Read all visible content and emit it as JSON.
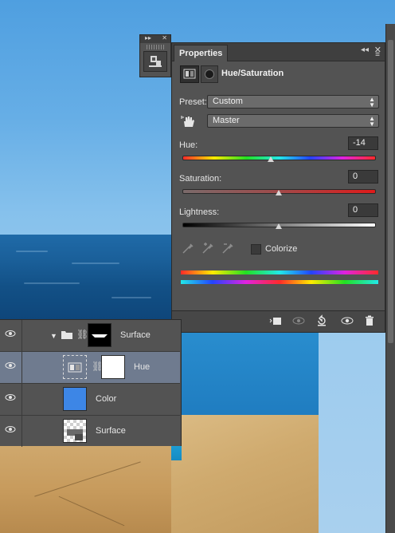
{
  "properties_panel": {
    "tab_label": "Properties",
    "collapse_icon": "◂◂",
    "close_icon": "✕",
    "menu_icon": "≡",
    "adjustment_title": "Hue/Saturation",
    "preset_label": "Preset:",
    "preset_value": "Custom",
    "channel_value": "Master",
    "hue_label": "Hue:",
    "hue_value": "-14",
    "hue_level": -14,
    "saturation_label": "Saturation:",
    "saturation_value": "0",
    "saturation_level": 0,
    "lightness_label": "Lightness:",
    "lightness_value": "0",
    "lightness_level": 0,
    "colorize_label": "Colorize",
    "colorize_checked": false
  },
  "layers": [
    {
      "name": "Surface",
      "type": "group",
      "visible": true,
      "selected": false
    },
    {
      "name": "Hue",
      "type": "adjustment",
      "visible": true,
      "selected": true
    },
    {
      "name": "Color",
      "type": "fill",
      "visible": true,
      "selected": false
    },
    {
      "name": "Surface",
      "type": "pixel",
      "visible": true,
      "selected": false
    }
  ],
  "colors": {
    "panel_bg": "#535353",
    "selected_row": "#6f7b8f",
    "color_fill": "#3d86e6"
  }
}
